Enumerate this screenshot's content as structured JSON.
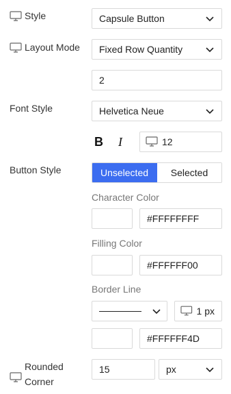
{
  "style": {
    "label": "Style",
    "value": "Capsule Button"
  },
  "layout_mode": {
    "label": "Layout Mode",
    "value": "Fixed Row Quantity",
    "row_quantity": "2"
  },
  "font_style": {
    "label": "Font Style",
    "value": "Helvetica Neue",
    "bold": "B",
    "italic": "I",
    "size": "12"
  },
  "button_style": {
    "label": "Button Style",
    "tabs": [
      "Unselected",
      "Selected"
    ],
    "active_tab": "Unselected",
    "character_color_label": "Character Color",
    "character_color": "#FFFFFFFF",
    "filling_color_label": "Filling Color",
    "filling_color": "#FFFFFF00",
    "border_line_label": "Border Line",
    "border_width": "1 px",
    "border_color": "#FFFFFF4D"
  },
  "rounded_corner": {
    "label": "Rounded Corner",
    "value": "15",
    "unit": "px"
  },
  "colors": {
    "accent": "#3c6df0",
    "border": "#d9d9d9"
  }
}
